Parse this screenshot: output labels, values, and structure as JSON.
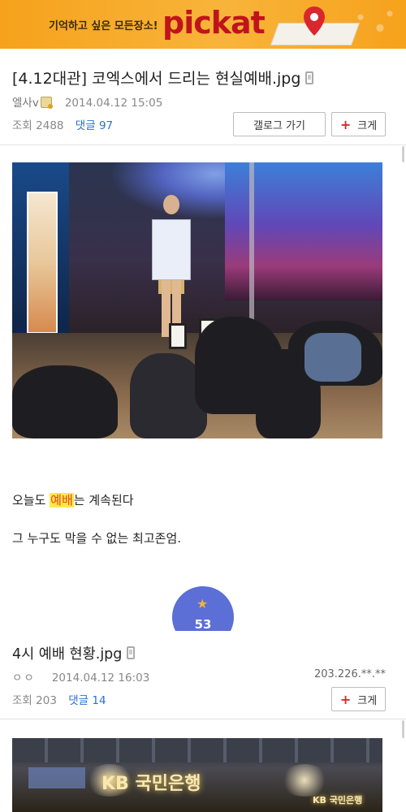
{
  "ad": {
    "tagline": "기억하고 싶은 모든장소!",
    "logo": "pickat",
    "brand_color": "#c0141c",
    "bg_color": "#f6a21c"
  },
  "post1": {
    "title": "[4.12대관] 코엑스에서 드리는 현실예배.jpg",
    "author": "엘사v",
    "date": "2014.04.12 15:05",
    "views_label": "조회",
    "views": "2488",
    "comments_label": "댓글",
    "comments": "97",
    "gallery_button": "갤로그 가기",
    "big_button": "크게",
    "body_line1_before": "오늘도 ",
    "body_line1_highlight": "예배",
    "body_line1_after": "는 계속된다",
    "body_line2": "그 누구도 막을 수 없는 최고존엄.",
    "recommend_count": "53"
  },
  "post2": {
    "title": "4시 예배 현황.jpg",
    "author": "ㅇㅇ",
    "date": "2014.04.12 16:03",
    "ip": "203.226.**.**",
    "views_label": "조회",
    "views": "203",
    "comments_label": "댓글",
    "comments": "14",
    "big_button": "크게",
    "photo_sign_main": "KB 국민은행",
    "photo_sign_small": "KB 국민은행"
  },
  "colors": {
    "comment_link": "#2d6fd3",
    "highlight_bg": "#ffe84a",
    "highlight_text": "#e0481e",
    "badge_bg": "#5b6fd6",
    "plus_red": "#d62b2b"
  },
  "icons": [
    "phone-icon",
    "level-icon",
    "plus-icon",
    "star-icon",
    "location-pin-icon"
  ]
}
